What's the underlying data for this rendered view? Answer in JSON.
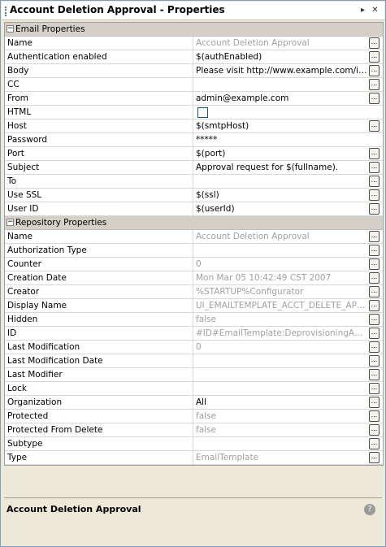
{
  "window": {
    "title": "Account Deletion Approval - Properties"
  },
  "email_properties": {
    "label": "Email Properties",
    "toggle": "−",
    "rows": [
      {
        "name": "Name",
        "value": "Account Deletion Approval",
        "dim": true,
        "button": true
      },
      {
        "name": "Authentication enabled",
        "value": "$(authEnabled)",
        "dim": false,
        "button": true
      },
      {
        "name": "Body",
        "value": "Please visit http://www.example.com/idm/user/approvals.jsp",
        "dim": false,
        "button": true
      },
      {
        "name": "CC",
        "value": "",
        "dim": false,
        "button": true
      },
      {
        "name": "From",
        "value": "admin@example.com",
        "dim": false,
        "button": true
      },
      {
        "name": "HTML",
        "value": "",
        "dim": false,
        "button": false,
        "checkbox": true
      },
      {
        "name": "Host",
        "value": "$(smtpHost)",
        "dim": false,
        "button": true
      },
      {
        "name": "Password",
        "value": "*****",
        "dim": false,
        "button": false
      },
      {
        "name": "Port",
        "value": "$(port)",
        "dim": false,
        "button": true
      },
      {
        "name": "Subject",
        "value": "Approval request for $(fullname).",
        "dim": false,
        "button": true
      },
      {
        "name": "To",
        "value": "",
        "dim": false,
        "button": true
      },
      {
        "name": "Use SSL",
        "value": "$(ssl)",
        "dim": false,
        "button": true
      },
      {
        "name": "User ID",
        "value": "$(userId)",
        "dim": false,
        "button": true
      }
    ]
  },
  "repository_properties": {
    "label": "Repository Properties",
    "toggle": "−",
    "rows": [
      {
        "name": "Name",
        "value": "Account Deletion Approval",
        "dim": true,
        "button": true
      },
      {
        "name": "Authorization Type",
        "value": "",
        "dim": false,
        "button": true
      },
      {
        "name": "Counter",
        "value": "0",
        "dim": true,
        "button": true
      },
      {
        "name": "Creation Date",
        "value": "Mon Mar 05 10:42:49 CST 2007",
        "dim": true,
        "button": true
      },
      {
        "name": "Creator",
        "value": "%STARTUP%Configurator",
        "dim": true,
        "button": true
      },
      {
        "name": "Display Name",
        "value": "UI_EMAILTEMPLATE_ACCT_DELETE_APPROVAL",
        "dim": true,
        "button": true
      },
      {
        "name": "Hidden",
        "value": "false",
        "dim": true,
        "button": true
      },
      {
        "name": "ID",
        "value": "#ID#EmailTemplate:DeprovisioningApprovalRequest",
        "dim": true,
        "button": true
      },
      {
        "name": "Last Modification",
        "value": "0",
        "dim": true,
        "button": true
      },
      {
        "name": "Last Modification Date",
        "value": "",
        "dim": false,
        "button": true
      },
      {
        "name": "Last Modifier",
        "value": "",
        "dim": false,
        "button": true
      },
      {
        "name": "Lock",
        "value": "",
        "dim": false,
        "button": true
      },
      {
        "name": "Organization",
        "value": "All",
        "dim": false,
        "button": true
      },
      {
        "name": "Protected",
        "value": "false",
        "dim": true,
        "button": true
      },
      {
        "name": "Protected From Delete",
        "value": "false",
        "dim": true,
        "button": true
      },
      {
        "name": "Subtype",
        "value": "",
        "dim": false,
        "button": true
      },
      {
        "name": "Type",
        "value": "EmailTemplate",
        "dim": true,
        "button": true
      }
    ]
  },
  "button_label": "...",
  "description": {
    "title": "Account Deletion Approval"
  },
  "icons": {
    "dock": "dock-icon",
    "close": "close-icon",
    "help": "help-icon"
  }
}
